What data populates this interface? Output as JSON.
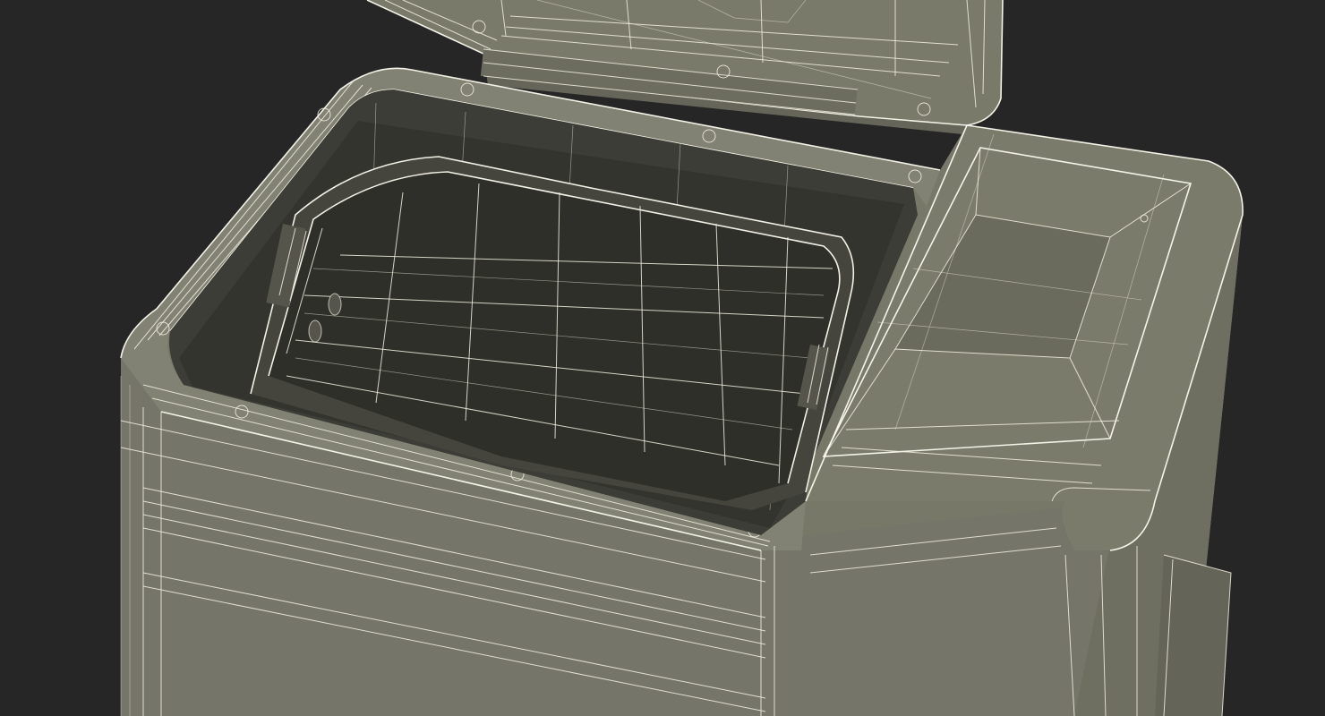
{
  "scene": {
    "background_color": "#262626",
    "body_color": "#787869",
    "body_shade_color": "#5e5e52",
    "interior_color": "#3b3b35",
    "wire_color": "#f2f0df"
  }
}
